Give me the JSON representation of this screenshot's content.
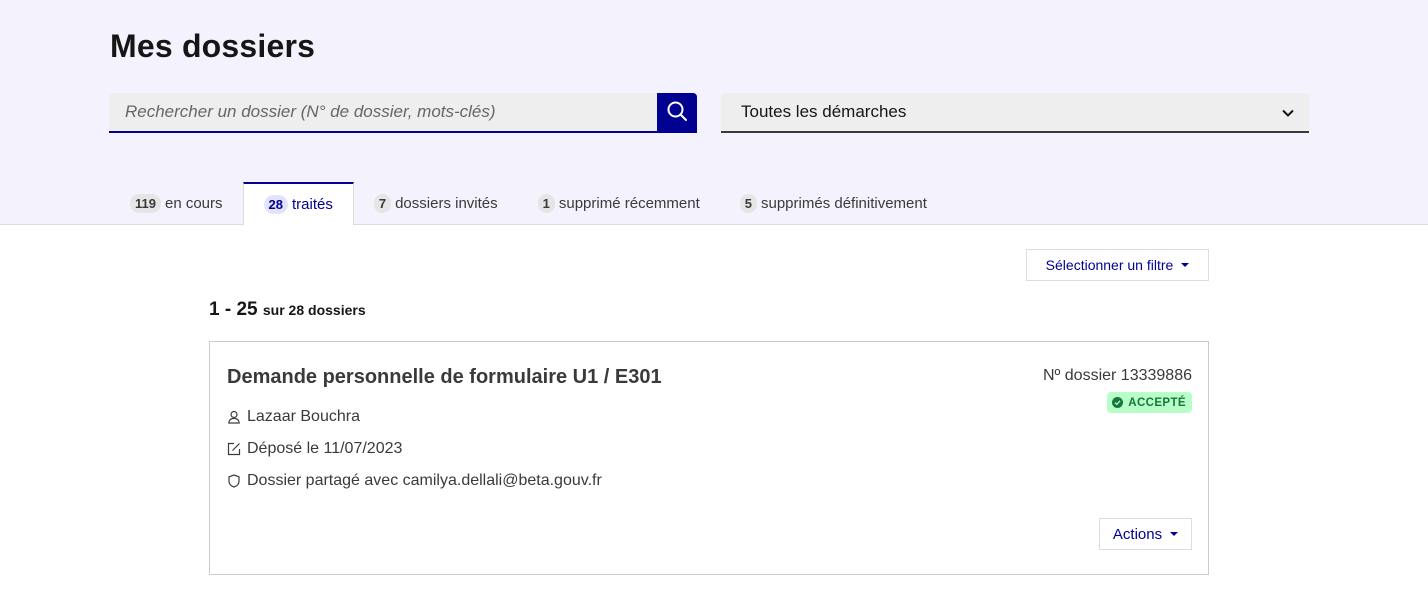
{
  "header": {
    "title": "Mes dossiers",
    "search": {
      "placeholder": "Rechercher un dossier (N° de dossier, mots-clés)",
      "value": ""
    },
    "procedure_select": {
      "selected": "Toutes les démarches"
    }
  },
  "tabs": [
    {
      "count": "119",
      "label": "en cours"
    },
    {
      "count": "28",
      "label": "traités",
      "active": true
    },
    {
      "count": "7",
      "label": "dossiers invités"
    },
    {
      "count": "1",
      "label": "supprimé récemment"
    },
    {
      "count": "5",
      "label": "supprimés définitivement"
    }
  ],
  "filter": {
    "label": "Sélectionner un filtre"
  },
  "results": {
    "range": "1 - 25",
    "total": "sur 28 dossiers"
  },
  "dossier": {
    "title": "Demande personnelle de formulaire U1 / E301",
    "number": "Nº dossier 13339886",
    "status": "ACCEPTÉ",
    "applicant": "Lazaar Bouchra",
    "deposit": "Déposé le 11/07/2023",
    "shared": "Dossier partagé avec camilya.dellali@beta.gouv.fr",
    "actions_label": "Actions"
  },
  "colors": {
    "primary": "#000091",
    "header_bg": "#f3f2fd",
    "success_bg": "#b8fec9",
    "success_text": "#18753c"
  },
  "icons": [
    "search-icon",
    "chevron-down-icon",
    "user-icon",
    "edit-box-icon",
    "shield-icon",
    "check-circle-icon",
    "caret-down-icon"
  ]
}
